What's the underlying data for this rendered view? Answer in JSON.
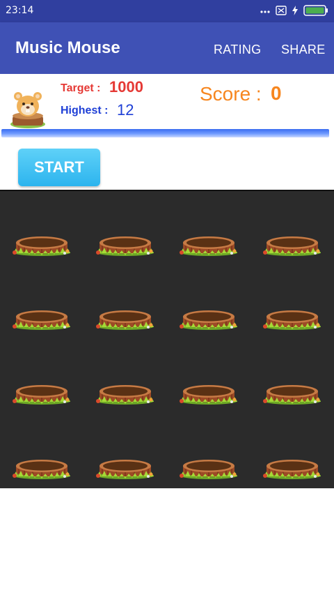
{
  "status_bar": {
    "time": "23:14",
    "icons": [
      "more-dots-icon",
      "sim-off-icon",
      "charging-icon",
      "battery-icon"
    ]
  },
  "app_bar": {
    "title": "Music Mouse",
    "actions": {
      "rating": "RATING",
      "share": "SHARE"
    },
    "color": "#3f51b5"
  },
  "info": {
    "target_label": "Target :",
    "target_value": "1000",
    "highest_label": "Highest :",
    "highest_value": "12",
    "score_label": "Score :",
    "score_value": "0",
    "target_color": "#e53935",
    "highest_color": "#1e3fd6",
    "score_color": "#f7861e"
  },
  "progress": {
    "fill_fraction": 0.99
  },
  "controls": {
    "start_label": "START"
  },
  "board": {
    "rows": 4,
    "cols": 4,
    "hole_icon": "tree-stump-hole-icon",
    "background": "#2b2b2b"
  }
}
